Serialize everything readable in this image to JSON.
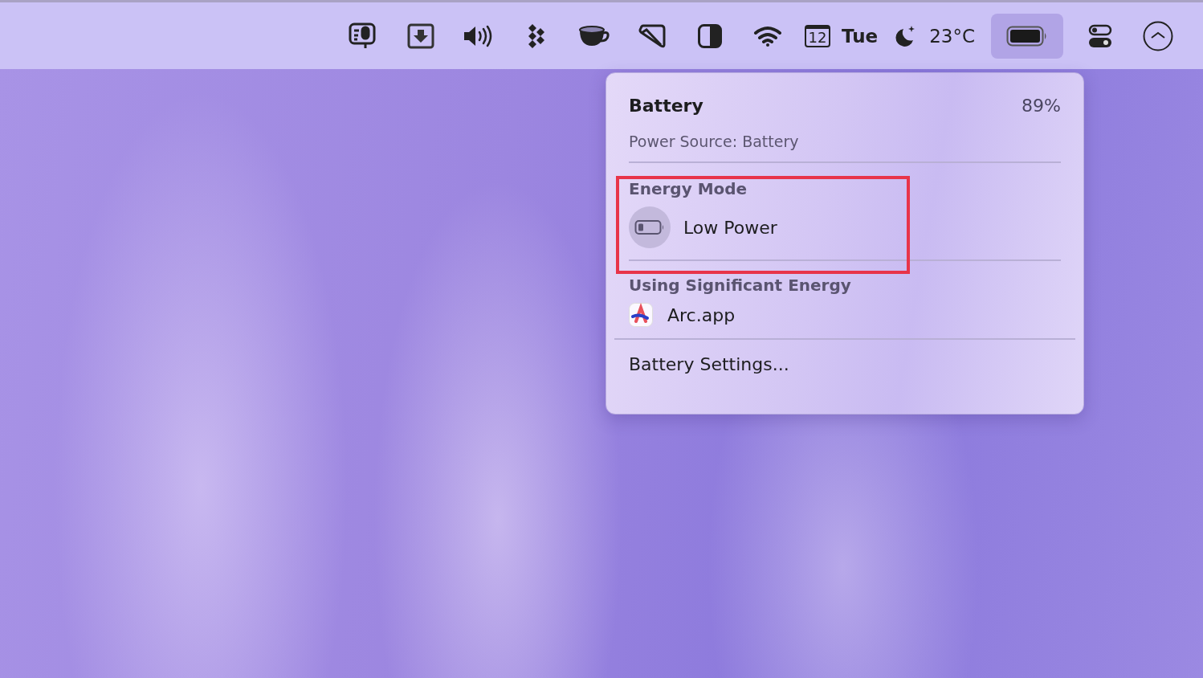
{
  "menu_bar": {
    "items": [
      {
        "kind": "icon",
        "selected": false
      },
      {
        "kind": "icon",
        "selected": false
      },
      {
        "kind": "icon",
        "selected": false
      },
      {
        "kind": "icon",
        "selected": false
      },
      {
        "kind": "icon",
        "selected": false
      },
      {
        "kind": "icon",
        "selected": false
      },
      {
        "kind": "icon",
        "selected": false
      },
      {
        "kind": "icon",
        "selected": false
      },
      {
        "kind": "calendar",
        "day": "12",
        "label": "Tue",
        "selected": false
      },
      {
        "kind": "weather",
        "label": "23°C",
        "selected": false
      },
      {
        "kind": "battery",
        "selected": true
      },
      {
        "kind": "icon",
        "selected": false
      },
      {
        "kind": "icon",
        "selected": false
      }
    ]
  },
  "battery_menu": {
    "title": "Battery",
    "percent": "89%",
    "power_source": "Power Source: Battery",
    "energy_mode": {
      "heading": "Energy Mode",
      "options": [
        {
          "label": "Low Power",
          "on": false
        }
      ]
    },
    "significant_energy": {
      "heading": "Using Significant Energy",
      "apps": [
        {
          "name": "Arc.app"
        }
      ]
    },
    "settings": "Battery Settings..."
  },
  "highlight": {
    "shown": true
  }
}
